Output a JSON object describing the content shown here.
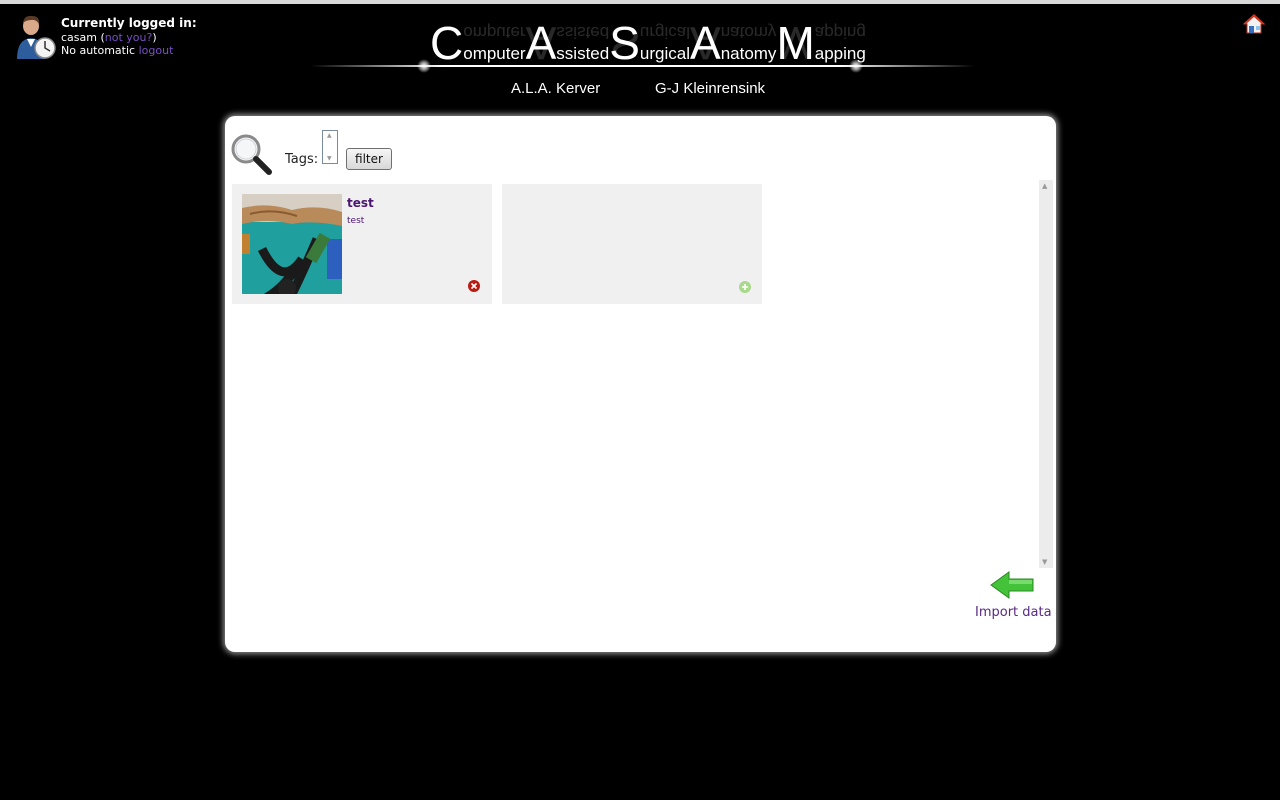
{
  "user": {
    "header": "Currently logged in:",
    "username": "casam",
    "paren_open": " (",
    "not_you": "not you?",
    "paren_close": ")",
    "auto_text": "No automatic ",
    "logout": "logout"
  },
  "logo": {
    "title": [
      {
        "big": "C",
        "small": "omputer"
      },
      {
        "big": "A",
        "small": "ssisted"
      },
      {
        "big": "S",
        "small": "urgical"
      },
      {
        "big": "A",
        "small": "natomy"
      },
      {
        "big": "M",
        "small": "apping"
      }
    ],
    "author_1": "A.L.A. Kerver",
    "author_2": "G-J Kleinrensink"
  },
  "search": {
    "tags_label": "Tags:",
    "filter_button": "filter"
  },
  "items": [
    {
      "title": "test",
      "subtitle": "test"
    }
  ],
  "import": {
    "label": "Import data"
  },
  "icons": {
    "user": "user-clock-icon",
    "home": "home-icon",
    "search": "magnifier-icon",
    "delete": "delete-icon",
    "add": "add-icon",
    "import": "arrow-left-icon"
  },
  "colors": {
    "background": "#000000",
    "panel": "#ffffff",
    "card": "#f0f0f0",
    "link": "#7a4fc7",
    "title": "#4a1470",
    "import_arrow": "#44c23a",
    "delete": "#b81c12"
  }
}
